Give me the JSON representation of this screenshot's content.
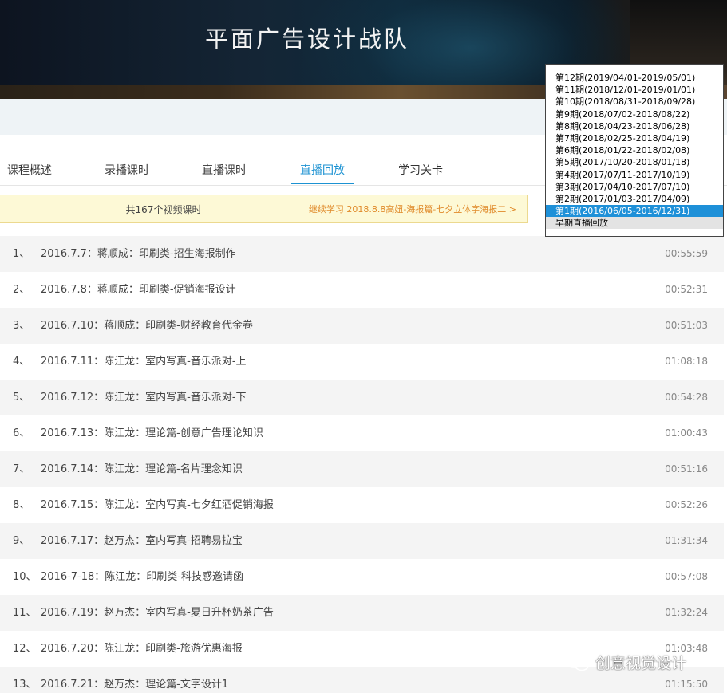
{
  "banner": {
    "title": "平面广告设计战队"
  },
  "tabs": [
    {
      "label": "课程概述"
    },
    {
      "label": "录播课时"
    },
    {
      "label": "直播课时"
    },
    {
      "label": "直播回放"
    },
    {
      "label": "学习关卡"
    }
  ],
  "active_tab": "直播回放",
  "notice": {
    "count_text": "共167个视频课时",
    "continue_text": "继续学习 2018.8.8高妞-海报篇-七夕立体字海报二 >"
  },
  "lessons": [
    {
      "index": "1、",
      "title": "2016.7.7：蒋顺成：印刷类-招生海报制作",
      "duration": "00:55:59"
    },
    {
      "index": "2、",
      "title": "2016.7.8：蒋顺成：印刷类-促销海报设计",
      "duration": "00:52:31"
    },
    {
      "index": "3、",
      "title": "2016.7.10：蒋顺成：印刷类-财经教育代金卷",
      "duration": "00:51:03"
    },
    {
      "index": "4、",
      "title": "2016.7.11：陈江龙：室内写真-音乐派对-上",
      "duration": "01:08:18"
    },
    {
      "index": "5、",
      "title": "2016.7.12：陈江龙：室内写真-音乐派对-下",
      "duration": "00:54:28"
    },
    {
      "index": "6、",
      "title": "2016.7.13：陈江龙：理论篇-创意广告理论知识",
      "duration": "01:00:43"
    },
    {
      "index": "7、",
      "title": "2016.7.14：陈江龙：理论篇-名片理念知识",
      "duration": "00:51:16"
    },
    {
      "index": "8、",
      "title": "2016.7.15：陈江龙：室内写真-七夕红酒促销海报",
      "duration": "00:52:26"
    },
    {
      "index": "9、",
      "title": "2016.7.17：赵万杰：室内写真-招聘易拉宝",
      "duration": "01:31:34"
    },
    {
      "index": "10、",
      "title": "2016-7-18：陈江龙：印刷类-科技感邀请函",
      "duration": "00:57:08"
    },
    {
      "index": "11、",
      "title": "2016.7.19：赵万杰：室内写真-夏日升杯奶茶广告",
      "duration": "01:32:24"
    },
    {
      "index": "12、",
      "title": "2016.7.20：陈江龙：印刷类-旅游优惠海报",
      "duration": "01:03:48"
    },
    {
      "index": "13、",
      "title": "2016.7.21：赵万杰：理论篇-文字设计1",
      "duration": "01:15:50"
    }
  ],
  "period_options": [
    "第12期(2019/04/01-2019/05/01)",
    "第11期(2018/12/01-2019/01/01)",
    "第10期(2018/08/31-2018/09/28)",
    "第9期(2018/07/02-2018/08/22)",
    "第8期(2018/04/23-2018/06/28)",
    "第7期(2018/02/25-2018/04/19)",
    "第6期(2018/01/22-2018/02/08)",
    "第5期(2017/10/20-2018/01/18)",
    "第4期(2017/07/11-2017/10/19)",
    "第3期(2017/04/10-2017/07/10)",
    "第2期(2017/01/03-2017/04/09)",
    "第1期(2016/06/05-2016/12/31)",
    "早期直播回放"
  ],
  "selected_period": "第1期(2016/06/05-2016/12/31)",
  "watermark": {
    "text": "创意视觉设计",
    "icon": "wechat-icon"
  },
  "colors": {
    "accent": "#1c92d2",
    "selected_option": "#1e90d8",
    "notice_bg": "#fdf9d6",
    "notice_link": "#e08a2a"
  }
}
